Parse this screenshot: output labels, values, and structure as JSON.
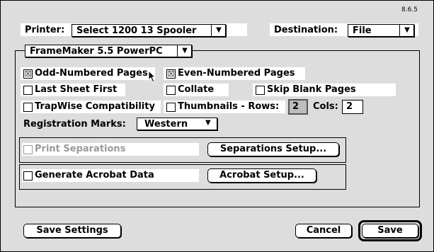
{
  "version": "8.6.5",
  "printer": {
    "label": "Printer:",
    "value": "Select 1200 13 Spooler"
  },
  "destination": {
    "label": "Destination:",
    "value": "File"
  },
  "plugin_popup": {
    "value": "FrameMaker 5.5 PowerPC"
  },
  "options": {
    "odd_pages": {
      "label": "Odd-Numbered Pages",
      "checked": true,
      "mark": "☒"
    },
    "even_pages": {
      "label": "Even-Numbered Pages",
      "checked": true,
      "mark": "☒"
    },
    "last_sheet_first": {
      "label": "Last Sheet First",
      "checked": false
    },
    "collate": {
      "label": "Collate",
      "checked": false
    },
    "skip_blank": {
      "label": "Skip Blank Pages",
      "checked": false
    },
    "trapwise": {
      "label": "TrapWise Compatibility",
      "checked": false
    },
    "thumbnails": {
      "label": "Thumbnails - Rows:",
      "checked": false
    }
  },
  "thumbnail_rows": "2",
  "thumbnail_cols_label": "Cols:",
  "thumbnail_cols": "2",
  "registration": {
    "label": "Registration Marks:",
    "value": "Western"
  },
  "separations": {
    "label": "Print Separations",
    "enabled": false,
    "button": "Separations Setup..."
  },
  "acrobat": {
    "label": "Generate Acrobat Data",
    "button": "Acrobat Setup..."
  },
  "buttons": {
    "save_settings": "Save Settings",
    "cancel": "Cancel",
    "save": "Save"
  },
  "colors": {
    "dialog_bg": "#dddddd",
    "disabled_text": "#999999"
  }
}
